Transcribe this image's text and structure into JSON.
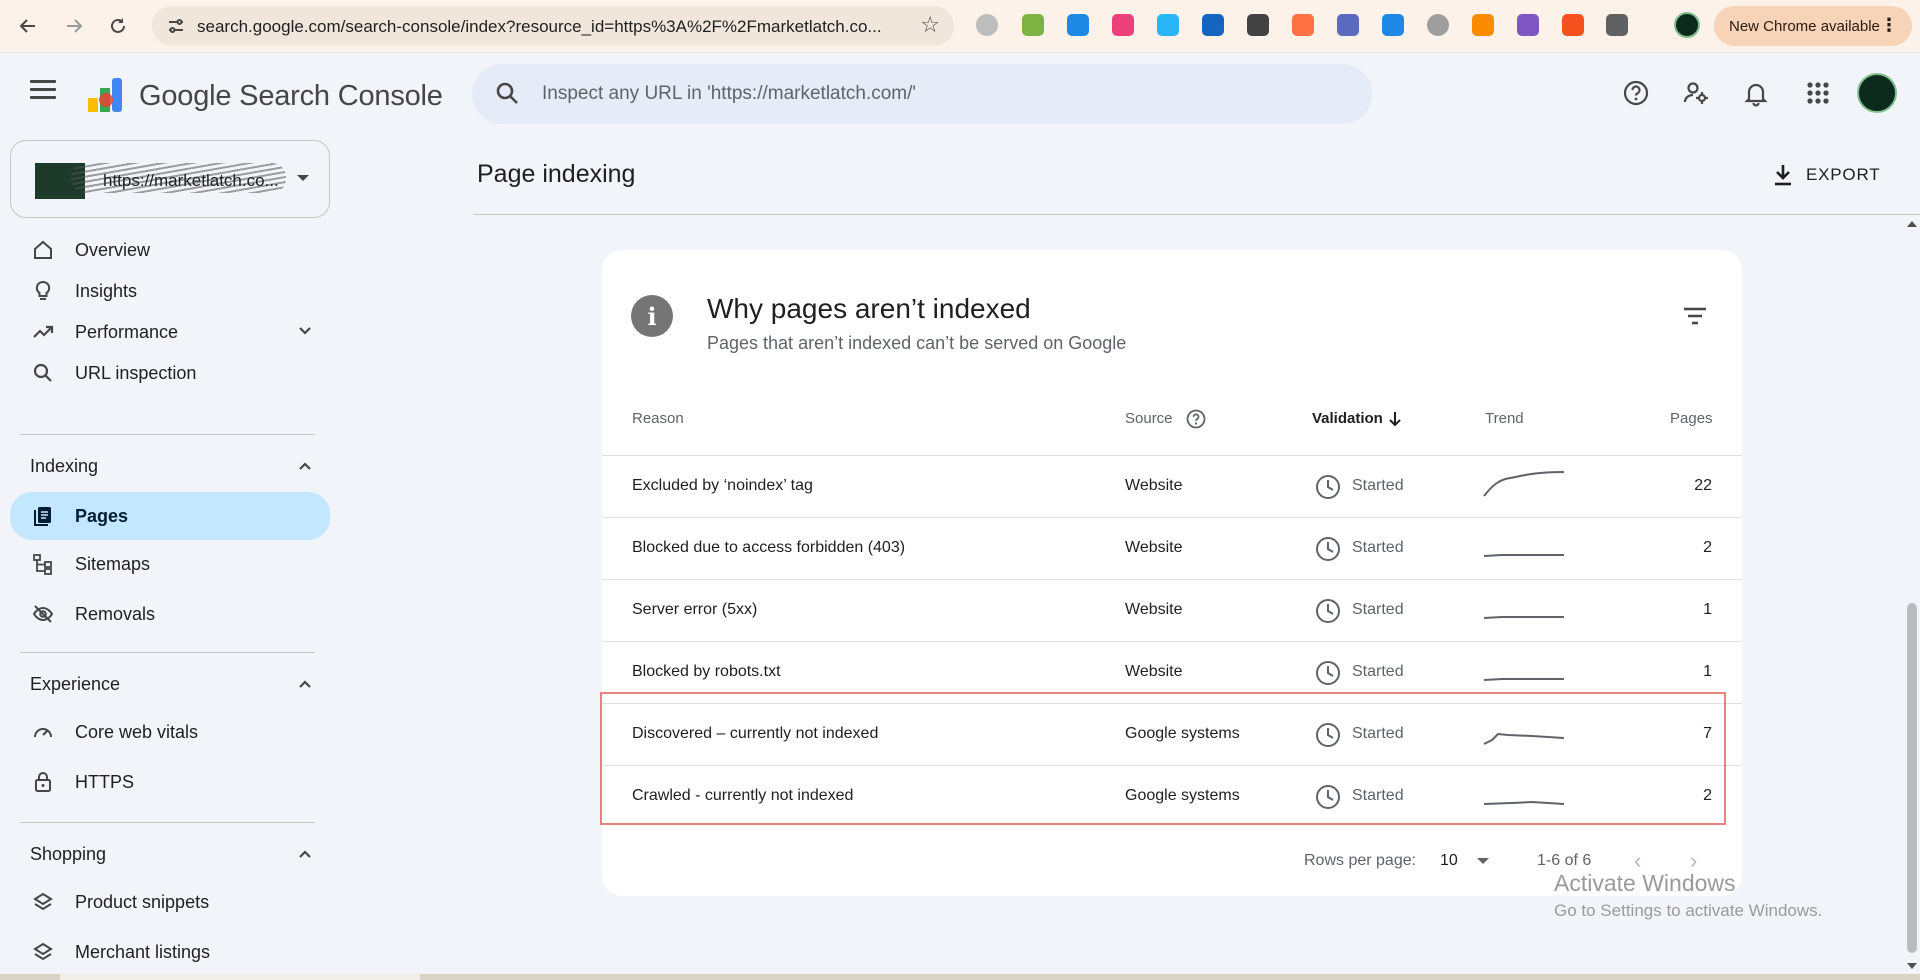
{
  "browser": {
    "url": "search.google.com/search-console/index?resource_id=https%3A%2F%2Fmarketlatch.co...",
    "new_chrome_label": "New Chrome available",
    "extension_colors": [
      "#bdbdbd",
      "#7cb342",
      "#1e88e5",
      "#ec407a",
      "#29b6f6",
      "#1565c0",
      "#424242",
      "#ff7043",
      "#5c6bc0",
      "#1e88e5",
      "#9e9e9e",
      "#fb8c00",
      "#7e57c2",
      "#f4511e",
      "#616161"
    ]
  },
  "header": {
    "product_title": "Google Search Console",
    "search_placeholder": "Inspect any URL in 'https://marketlatch.com/'",
    "icons": [
      "help-icon",
      "manage-users-icon",
      "notifications-icon",
      "apps-icon"
    ]
  },
  "sidebar": {
    "property_name": "https://marketlatch.co...",
    "items_top": [
      {
        "label": "Overview",
        "icon": "home-icon"
      },
      {
        "label": "Insights",
        "icon": "lightbulb-icon"
      },
      {
        "label": "Performance",
        "icon": "trending-up-icon"
      },
      {
        "label": "URL inspection",
        "icon": "search-icon"
      }
    ],
    "sections": [
      {
        "label": "Indexing",
        "items": [
          {
            "label": "Pages",
            "icon": "pages-icon",
            "active": true
          },
          {
            "label": "Sitemaps",
            "icon": "sitemap-icon"
          },
          {
            "label": "Removals",
            "icon": "visibility-off-icon"
          }
        ]
      },
      {
        "label": "Experience",
        "items": [
          {
            "label": "Core web vitals",
            "icon": "speed-icon"
          },
          {
            "label": "HTTPS",
            "icon": "lock-icon"
          }
        ]
      },
      {
        "label": "Shopping",
        "items": [
          {
            "label": "Product snippets",
            "icon": "layers-icon"
          },
          {
            "label": "Merchant listings",
            "icon": "layers-icon"
          }
        ]
      }
    ]
  },
  "main": {
    "page_title": "Page indexing",
    "export_label": "EXPORT",
    "card": {
      "title": "Why pages aren’t indexed",
      "subtitle": "Pages that aren’t indexed can’t be served on Google",
      "columns": [
        "Reason",
        "Source",
        "Validation",
        "Trend",
        "Pages"
      ],
      "rows": [
        {
          "reason": "Excluded by ‘noindex’ tag",
          "source": "Website",
          "status": "Started",
          "pages": "22",
          "trend": "rising"
        },
        {
          "reason": "Blocked due to access forbidden (403)",
          "source": "Website",
          "status": "Started",
          "pages": "2",
          "trend": "flat"
        },
        {
          "reason": "Server error (5xx)",
          "source": "Website",
          "status": "Started",
          "pages": "1",
          "trend": "flat"
        },
        {
          "reason": "Blocked by robots.txt",
          "source": "Website",
          "status": "Started",
          "pages": "1",
          "trend": "flat"
        },
        {
          "reason": "Discovered – currently not indexed",
          "source": "Google systems",
          "status": "Started",
          "pages": "7",
          "trend": "bump"
        },
        {
          "reason": "Crawled - currently not indexed",
          "source": "Google systems",
          "status": "Started",
          "pages": "2",
          "trend": "slight"
        }
      ],
      "pagination": {
        "rows_per_page_label": "Rows per page:",
        "rows_per_page": "10",
        "range": "1-6 of 6"
      }
    }
  },
  "watermark": {
    "line1": "Activate Windows",
    "line2": "Go to Settings to activate Windows."
  },
  "colors": {
    "active_nav": "#c2e7ff",
    "background": "#f1f4f9",
    "highlight": "#e45858",
    "chrome_bar": "#fdf2e9"
  }
}
